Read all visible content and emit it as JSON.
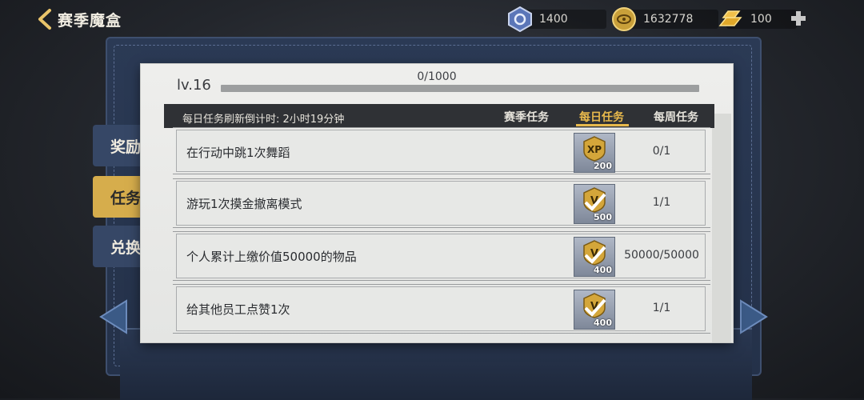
{
  "header": {
    "title": "赛季魔盒"
  },
  "currencies": [
    {
      "icon": "blue-token-icon",
      "value": "1400",
      "color": "#5b76b8"
    },
    {
      "icon": "gold-coin-icon",
      "value": "1632778",
      "color": "#c9a03a"
    },
    {
      "icon": "gold-bar-icon",
      "value": "100",
      "color": "#e0a82a"
    }
  ],
  "side_tabs": [
    {
      "label": "奖励",
      "active": false
    },
    {
      "label": "任务",
      "active": true
    },
    {
      "label": "兑换",
      "active": false
    }
  ],
  "level": {
    "label": "lv.16",
    "progress_text": "0/1000",
    "progress_fraction": 0.0
  },
  "countdown": "每日任务刷新倒计时: 2小时19分钟",
  "tabs": [
    {
      "label": "赛季任务",
      "active": false
    },
    {
      "label": "每日任务",
      "active": true
    },
    {
      "label": "每周任务",
      "active": false
    }
  ],
  "tasks": [
    {
      "text": "在行动中跳1次舞蹈",
      "reward_icon": "xp-badge-icon",
      "reward_amount": "200",
      "progress": "0/1",
      "completed": false
    },
    {
      "text": "游玩1次摸金撤离模式",
      "reward_icon": "v-badge-check-icon",
      "reward_amount": "500",
      "progress": "1/1",
      "completed": true
    },
    {
      "text": "个人累计上缴价值50000的物品",
      "reward_icon": "v-badge-check-icon",
      "reward_amount": "400",
      "progress": "50000/50000",
      "completed": true
    },
    {
      "text": "给其他员工点赞1次",
      "reward_icon": "v-badge-check-icon",
      "reward_amount": "400",
      "progress": "1/1",
      "completed": true
    }
  ]
}
